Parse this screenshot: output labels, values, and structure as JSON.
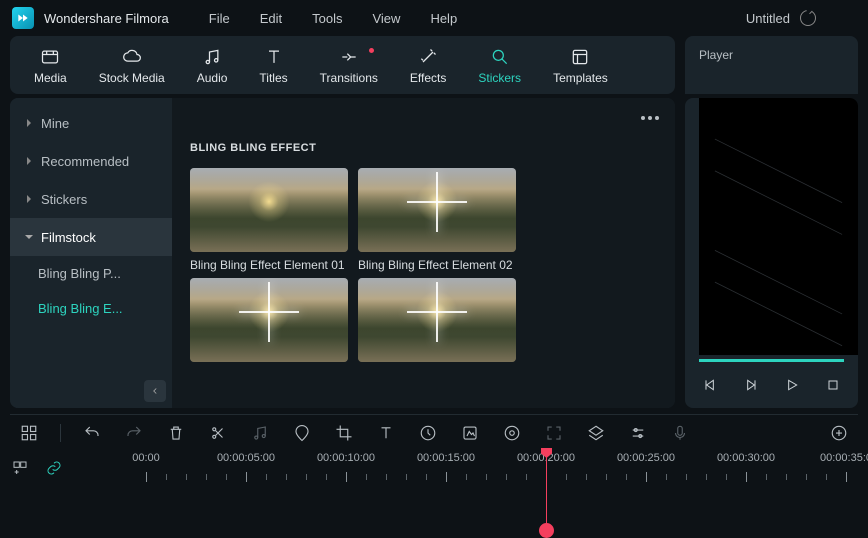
{
  "app_title": "Wondershare Filmora",
  "project_title": "Untitled",
  "menubar": [
    "File",
    "Edit",
    "Tools",
    "View",
    "Help"
  ],
  "mode_tabs": [
    "Media",
    "Stock Media",
    "Audio",
    "Titles",
    "Transitions",
    "Effects",
    "Stickers",
    "Templates"
  ],
  "active_mode_tab": "Stickers",
  "sidebar": {
    "items": [
      {
        "label": "Mine",
        "expanded": false
      },
      {
        "label": "Recommended",
        "expanded": false
      },
      {
        "label": "Stickers",
        "expanded": false
      },
      {
        "label": "Filmstock",
        "expanded": true,
        "selected": true,
        "children": [
          {
            "label": "Bling Bling P...",
            "active": false
          },
          {
            "label": "Bling Bling E...",
            "active": true
          }
        ]
      }
    ]
  },
  "section_title": "BLING BLING EFFECT",
  "cards": [
    {
      "label": "Bling Bling Effect Element 01",
      "variant": "glow"
    },
    {
      "label": "Bling Bling Effect Element 02",
      "variant": "star"
    },
    {
      "label": "",
      "variant": "star"
    },
    {
      "label": "",
      "variant": "star"
    }
  ],
  "player": {
    "title": "Player"
  },
  "timeline": {
    "labels": [
      "00:00",
      "00:00:05:00",
      "00:00:10:00",
      "00:00:15:00",
      "00:00:20:00",
      "00:00:25:00",
      "00:00:30:00",
      "00:00:35:0"
    ],
    "playhead_time": "00:00:20:00"
  }
}
